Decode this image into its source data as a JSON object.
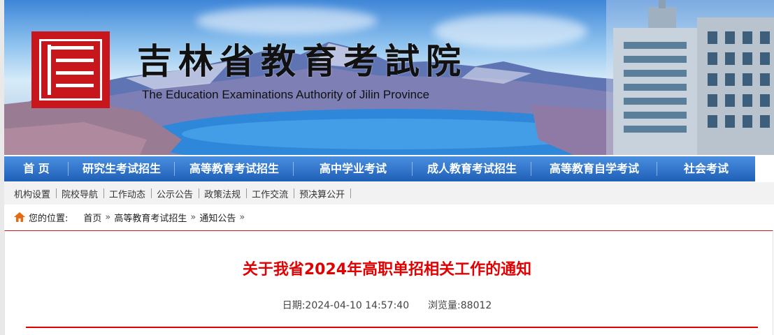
{
  "header": {
    "title": "吉林省教育考試院",
    "subtitle": "The Education Examinations Authority of Jilin Province"
  },
  "main_nav": [
    {
      "label": "首 页"
    },
    {
      "label": "研究生考试招生"
    },
    {
      "label": "高等教育考试招生"
    },
    {
      "label": "高中学业考试"
    },
    {
      "label": "成人教育考试招生"
    },
    {
      "label": "高等教育自学考试"
    },
    {
      "label": "社会考试"
    }
  ],
  "sub_nav": [
    {
      "label": "机构设置"
    },
    {
      "label": "院校导航"
    },
    {
      "label": "工作动态"
    },
    {
      "label": "公示公告"
    },
    {
      "label": "政策法规"
    },
    {
      "label": "工作交流"
    },
    {
      "label": "预决算公开"
    }
  ],
  "breadcrumb": {
    "prefix": "您的位置:",
    "items": [
      {
        "label": "首页"
      },
      {
        "label": "高等教育考试招生"
      },
      {
        "label": "通知公告"
      }
    ],
    "separator": "»"
  },
  "article": {
    "title": "关于我省2024年高职单招相关工作的通知",
    "date_label": "日期:",
    "date": "2024-04-10 14:57:40",
    "views_label": "浏览量:",
    "views": "88012"
  },
  "colors": {
    "nav_blue": "#2a6dc7",
    "title_red": "#e20000",
    "logo_red": "#c8161d"
  },
  "icons": {
    "home": "home-icon",
    "logo": "seal-logo"
  }
}
